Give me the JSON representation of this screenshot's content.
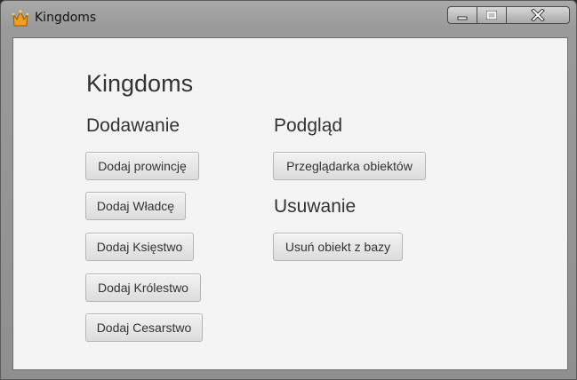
{
  "window": {
    "title": "Kingdoms",
    "controls": {
      "minimize_icon": "minimize-icon",
      "maximize_icon": "maximize-icon",
      "close_icon": "close-icon"
    }
  },
  "main": {
    "title": "Kingdoms",
    "sections": {
      "adding": {
        "heading": "Dodawanie",
        "buttons": [
          "Dodaj prowincję",
          "Dodaj Władcę",
          "Dodaj Księstwo",
          "Dodaj Królestwo",
          "Dodaj Cesarstwo"
        ]
      },
      "preview": {
        "heading": "Podgląd",
        "buttons": [
          "Przeglądarka obiektów"
        ]
      },
      "removing": {
        "heading": "Usuwanie",
        "buttons": [
          "Usuń obiekt z bazy"
        ]
      }
    }
  },
  "colors": {
    "client_bg": "#f4f4f4",
    "icon_gold": "#f0a020"
  }
}
